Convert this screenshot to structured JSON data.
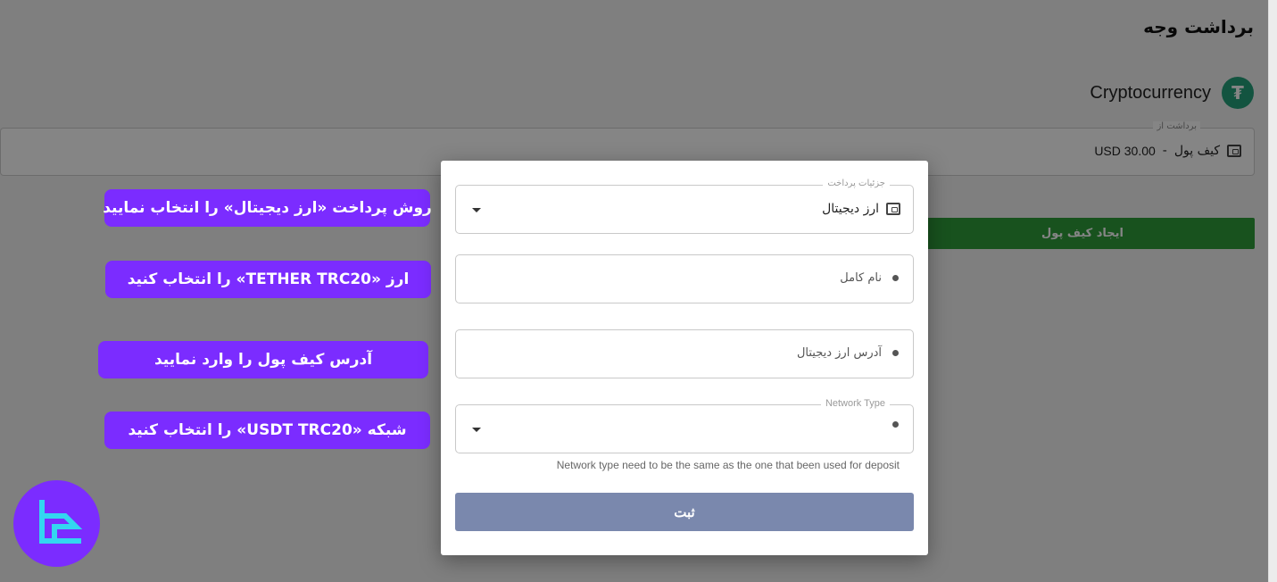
{
  "page": {
    "title": "برداشت وجه",
    "crypto_name": "Cryptocurrency",
    "crypto_icon": "₮",
    "from_legend": "برداشت از",
    "from_wallet_label": "کیف پول",
    "from_separator": "-",
    "from_amount": "USD 30.00",
    "create_wallet_label": "ایجاد کیف پول"
  },
  "modal": {
    "payment_details_legend": "جزئیات پرداخت",
    "payment_method_value": "ارز دیجیتال",
    "full_name_placeholder": "نام کامل",
    "crypto_address_placeholder": "آدرس ارز دیجیتال",
    "network_type_legend": "Network Type",
    "network_helper": "Network type need to be the same as the one that been used for deposit",
    "submit_label": "ثبت"
  },
  "callouts": [
    "روش پرداخت «ارز دیجیتال» را انتخاب نمایید",
    "ارز «TETHER TRC20» را انتخاب کنید",
    "آدرس کیف پول را وارد نمایید",
    "شبکه «USDT TRC20» را انتخاب کنید"
  ],
  "colors": {
    "accent_purple": "#7b2cff",
    "tether_green": "#26a17b",
    "submit_disabled": "#7a88ad",
    "green_button": "#2e9e3a"
  }
}
